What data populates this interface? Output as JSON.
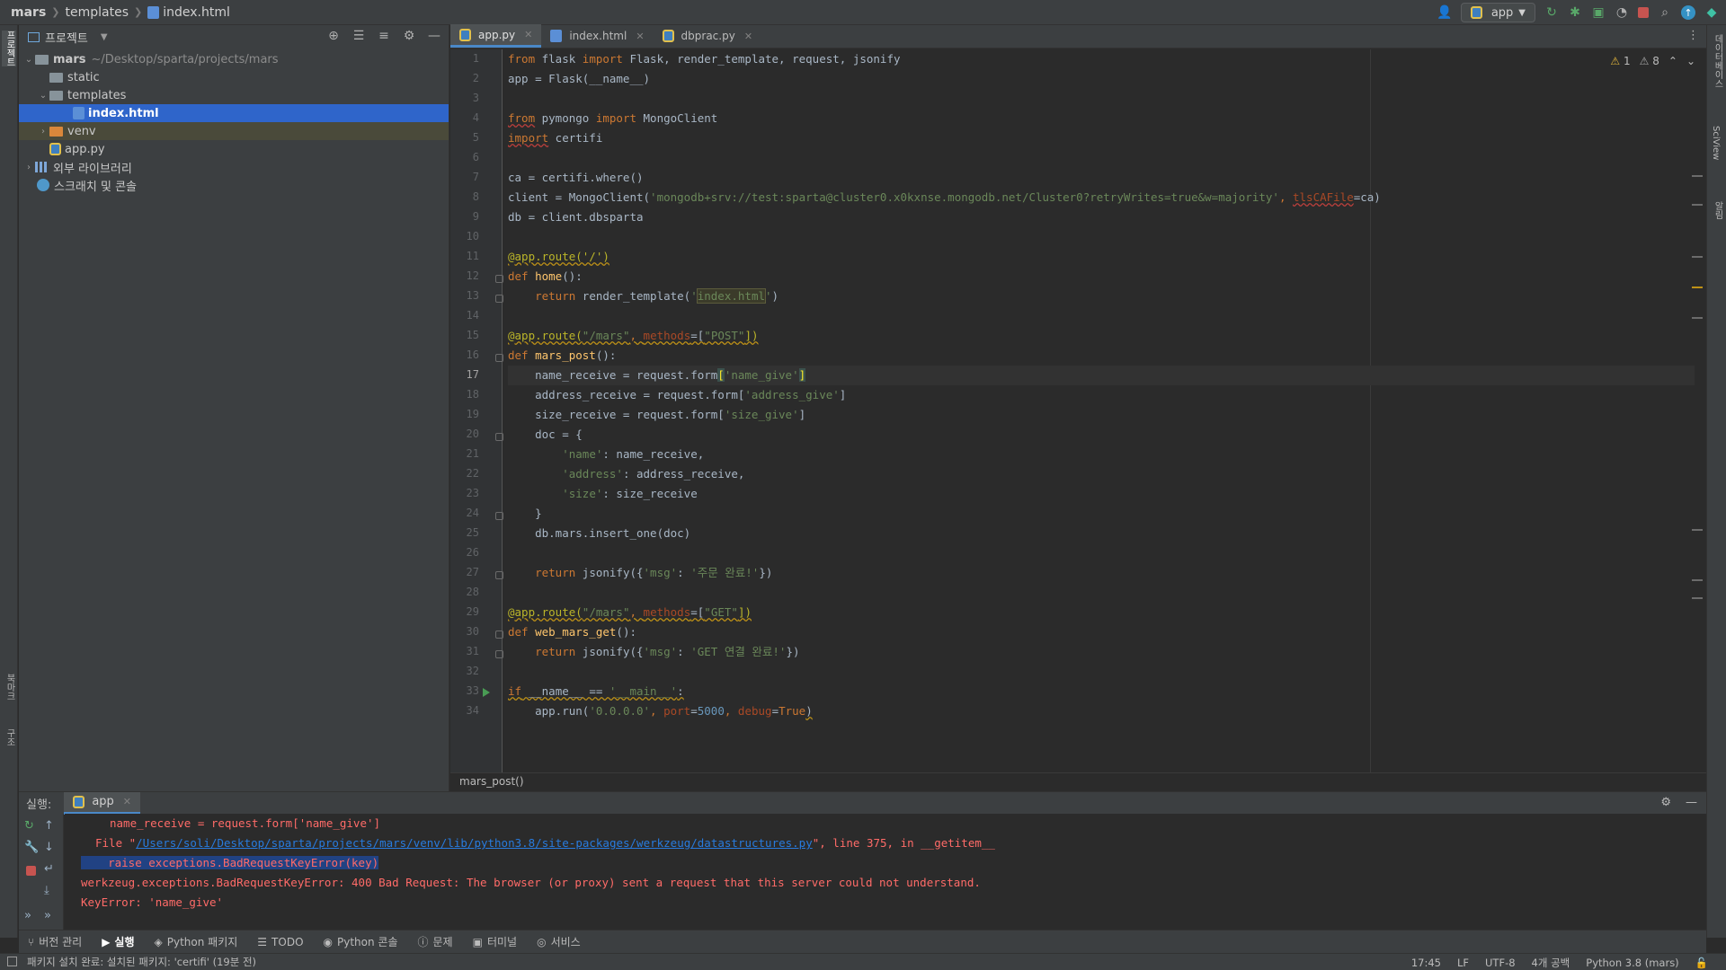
{
  "breadcrumb": {
    "root": "mars",
    "folder": "templates",
    "file": "index.html"
  },
  "toolbar": {
    "run_config": "app"
  },
  "left_strip": {
    "project_tab": "프로젝트",
    "bookmarks_tab": "북마크",
    "structure_tab": "구조"
  },
  "right_strip": {
    "database_tab": "데이터베이스",
    "sciview_tab": "SciView",
    "notifications_tab": "알림"
  },
  "project": {
    "title": "프로젝트",
    "root": {
      "name": "mars",
      "path": "~/Desktop/sparta/projects/mars"
    },
    "items": [
      {
        "name": "static"
      },
      {
        "name": "templates"
      },
      {
        "name": "index.html"
      },
      {
        "name": "venv"
      },
      {
        "name": "app.py"
      },
      {
        "name": "외부 라이브러리"
      },
      {
        "name": "스크래치 및 콘솔"
      }
    ]
  },
  "tabs": [
    {
      "label": "app.py"
    },
    {
      "label": "index.html"
    },
    {
      "label": "dbprac.py"
    }
  ],
  "inspections": {
    "warnings": "1",
    "weak_warnings": "8"
  },
  "code_lines": [
    "1",
    "2",
    "3",
    "4",
    "5",
    "6",
    "7",
    "8",
    "9",
    "10",
    "11",
    "12",
    "13",
    "14",
    "15",
    "16",
    "17",
    "18",
    "19",
    "20",
    "21",
    "22",
    "23",
    "24",
    "25",
    "26",
    "27",
    "28",
    "29",
    "30",
    "31",
    "32",
    "33",
    "34"
  ],
  "code": {
    "l1": {
      "a": "from",
      "b": " flask ",
      "c": "import",
      "d": " Flask, render_template, request, jsonify"
    },
    "l2": "app = Flask(__name__)",
    "l4": {
      "a": "from",
      "b": " pymongo ",
      "c": "import",
      "d": " MongoClient"
    },
    "l5": {
      "a": "import",
      "b": " certifi"
    },
    "l7": "ca = certifi.where()",
    "l8": {
      "a": "client = MongoClient(",
      "b": "'mongodb+srv://test:sparta@cluster0.x0kxnse.mongodb.net/Cluster0?retryWrites=true&w=majority'",
      "c": ", ",
      "d": "tlsCAFile",
      "e": "=ca)"
    },
    "l9": "db = client.dbsparta",
    "l11": "@app.route('/')",
    "l12": {
      "a": "def",
      "b": " home",
      "c": "():"
    },
    "l13": {
      "a": "    return",
      "b": " render_template(",
      "c": "'",
      "d": "index.html",
      "e": "'",
      "f": ")"
    },
    "l15": {
      "a": "@app.route(",
      "b": "\"/mars\"",
      "c": ", ",
      "d": "methods",
      "e": "=[",
      "f": "\"POST\"",
      "g": "])"
    },
    "l16": {
      "a": "def",
      "b": " mars_post",
      "c": "():"
    },
    "l17": {
      "a": "    name_receive = request.form",
      "b": "[",
      "c": "'name_give'",
      "d": "]"
    },
    "l18": {
      "a": "    address_receive = request.form[",
      "b": "'address_give'",
      "c": "]"
    },
    "l19": {
      "a": "    size_receive = request.form[",
      "b": "'size_give'",
      "c": "]"
    },
    "l20": "    doc = {",
    "l21": {
      "a": "        ",
      "b": "'name'",
      "c": ": name_receive,"
    },
    "l22": {
      "a": "        ",
      "b": "'address'",
      "c": ": address_receive,"
    },
    "l23": {
      "a": "        ",
      "b": "'size'",
      "c": ": size_receive"
    },
    "l24": "    }",
    "l25": "    db.mars.insert_one(doc)",
    "l27": {
      "a": "    return",
      "b": " jsonify({",
      "c": "'msg'",
      "d": ": ",
      "e": "'주문 완료!'",
      "f": "})"
    },
    "l29": {
      "a": "@app.route(",
      "b": "\"/mars\"",
      "c": ", ",
      "d": "methods",
      "e": "=[",
      "f": "\"GET\"",
      "g": "])"
    },
    "l30": {
      "a": "def",
      "b": " web_mars_get",
      "c": "():"
    },
    "l31": {
      "a": "    return",
      "b": " jsonify({",
      "c": "'msg'",
      "d": ": ",
      "e": "'GET 연결 완료!'",
      "f": "})"
    },
    "l33": {
      "a": "if",
      "b": " __name__ == ",
      "c": "'__main__'",
      "d": ":"
    },
    "l34": {
      "a": "    app.run(",
      "b": "'0.0.0.0'",
      "c": ", ",
      "d": "port",
      "e": "=",
      "f": "5000",
      "g": ", ",
      "h": "debug",
      "i": "=",
      "j": "True",
      "k": ")"
    }
  },
  "editor_breadcrumb": "mars_post()",
  "run": {
    "label": "실행:",
    "tab": "app",
    "lines": {
      "c1": "name_receive = request.form['name_give']",
      "c2a": "File \"",
      "c2b": "/Users/soli/Desktop/sparta/projects/mars/venv/lib/python3.8/site-packages/werkzeug/datastructures.py",
      "c2c": "\", line 375, in __getitem__",
      "c3": "raise exceptions.BadRequestKeyError(key)",
      "c4": "werkzeug.exceptions.BadRequestKeyError: 400 Bad Request: The browser (or proxy) sent a request that this server could not understand.",
      "c5": "KeyError: 'name_give'"
    }
  },
  "bottom_tabs": [
    {
      "label": "버전 관리"
    },
    {
      "label": "실행"
    },
    {
      "label": "Python 패키지"
    },
    {
      "label": "TODO"
    },
    {
      "label": "Python 콘솔"
    },
    {
      "label": "문제"
    },
    {
      "label": "터미널"
    },
    {
      "label": "서비스"
    }
  ],
  "status": {
    "message": "패키지 설치 완료: 설치된 패키지: 'certifi' (19분 전)",
    "position": "17:45",
    "line_sep": "LF",
    "encoding": "UTF-8",
    "indent": "4개 공백",
    "interpreter": "Python 3.8 (mars)"
  }
}
